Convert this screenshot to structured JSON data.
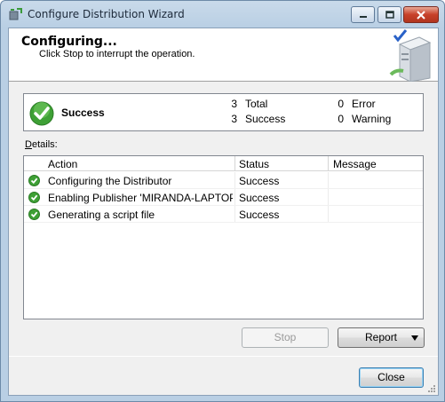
{
  "window": {
    "title": "Configure Distribution Wizard",
    "icon": "wizard-icon"
  },
  "header": {
    "title": "Configuring...",
    "subtitle": "Click Stop to interrupt the operation.",
    "art_icon": "server-check-icon"
  },
  "summary": {
    "status": "Success",
    "total_count": "3",
    "total_label": "Total",
    "success_count": "3",
    "success_label": "Success",
    "error_count": "0",
    "error_label": "Error",
    "warning_count": "0",
    "warning_label": "Warning"
  },
  "details": {
    "label_prefix": "D",
    "label_rest": "etails:",
    "columns": [
      "Action",
      "Status",
      "Message"
    ],
    "rows": [
      {
        "action": "Configuring the Distributor",
        "status": "Success",
        "message": ""
      },
      {
        "action": "Enabling Publisher 'MIRANDA-LAPTOP...",
        "status": "Success",
        "message": ""
      },
      {
        "action": "Generating a script file",
        "status": "Success",
        "message": ""
      }
    ]
  },
  "buttons": {
    "stop": "Stop",
    "report": "Report",
    "close": "Close"
  },
  "colors": {
    "success_green": "#3ea035",
    "titlebar": "#c9daea",
    "close_red": "#c7412a"
  }
}
